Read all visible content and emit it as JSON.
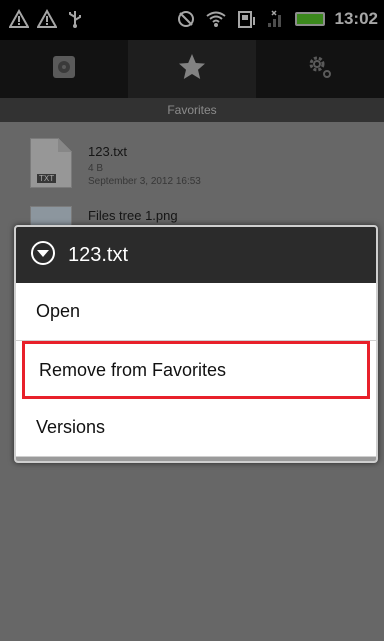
{
  "statusbar": {
    "time": "13:02",
    "icons_left": [
      "warning-icon",
      "warning-icon",
      "usb-icon"
    ],
    "icons_right": [
      "sync-icon",
      "wifi-icon",
      "storage-icon",
      "signal-icon",
      "battery-icon"
    ]
  },
  "tabs": [
    {
      "name": "storage-tab",
      "icon": "disk-icon",
      "active": false
    },
    {
      "name": "favorites-tab",
      "icon": "star-icon",
      "active": true
    },
    {
      "name": "settings-tab",
      "icon": "gear-icon",
      "active": false
    }
  ],
  "section_title": "Favorites",
  "files": [
    {
      "name": "123.txt",
      "size": "4 B",
      "date": "September 3, 2012 16:53",
      "ext": "TXT"
    },
    {
      "name": "Files tree 1.png"
    }
  ],
  "dialog": {
    "title": "123.txt",
    "items": [
      "Open",
      "Remove from Favorites",
      "Versions"
    ],
    "highlight_color": "#e8202a"
  }
}
